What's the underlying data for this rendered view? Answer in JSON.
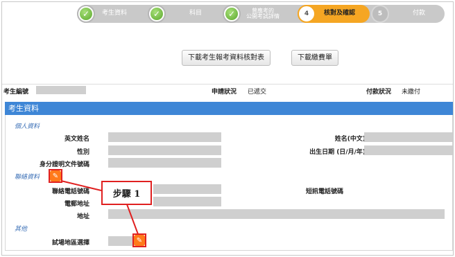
{
  "steps": [
    {
      "label": "考生資料",
      "state": "done"
    },
    {
      "label": "科目",
      "state": "done"
    },
    {
      "label": "曾應考的\n公開考試詳情",
      "state": "done"
    },
    {
      "label": "核對及確認",
      "number": "4",
      "state": "active"
    },
    {
      "label": "付款",
      "number": "5",
      "state": "future"
    }
  ],
  "buttons": {
    "download_form": "下載考生報考資料核對表",
    "download_bill": "下載繳費單"
  },
  "status": {
    "candidate_no_label": "考生編號",
    "application_status_label": "申請狀況",
    "application_status_value": "已遞交",
    "payment_status_label": "付款狀況",
    "payment_status_value": "未繳付"
  },
  "section": {
    "title": "考生資料",
    "personal": {
      "heading": "個人資料",
      "english_name": "英文姓名",
      "chinese_name": "姓名(中文)",
      "gender": "性別",
      "dob": "出生日期 (日/月/年)",
      "id_doc": "身分證明文件號碼"
    },
    "contact": {
      "heading": "聯絡資料",
      "phone": "聯絡電話號碼",
      "sms": "短訊電話號碼",
      "email": "電郵地址",
      "address": "地址"
    },
    "other": {
      "heading": "其他",
      "region": "試場地區選擇"
    }
  },
  "callout": {
    "text": "步驟 1"
  },
  "colors": {
    "accent_blue": "#3e86d6",
    "active_step": "#f5a623",
    "highlight_red": "#e02020",
    "edit_orange": "#ff7a1a"
  }
}
